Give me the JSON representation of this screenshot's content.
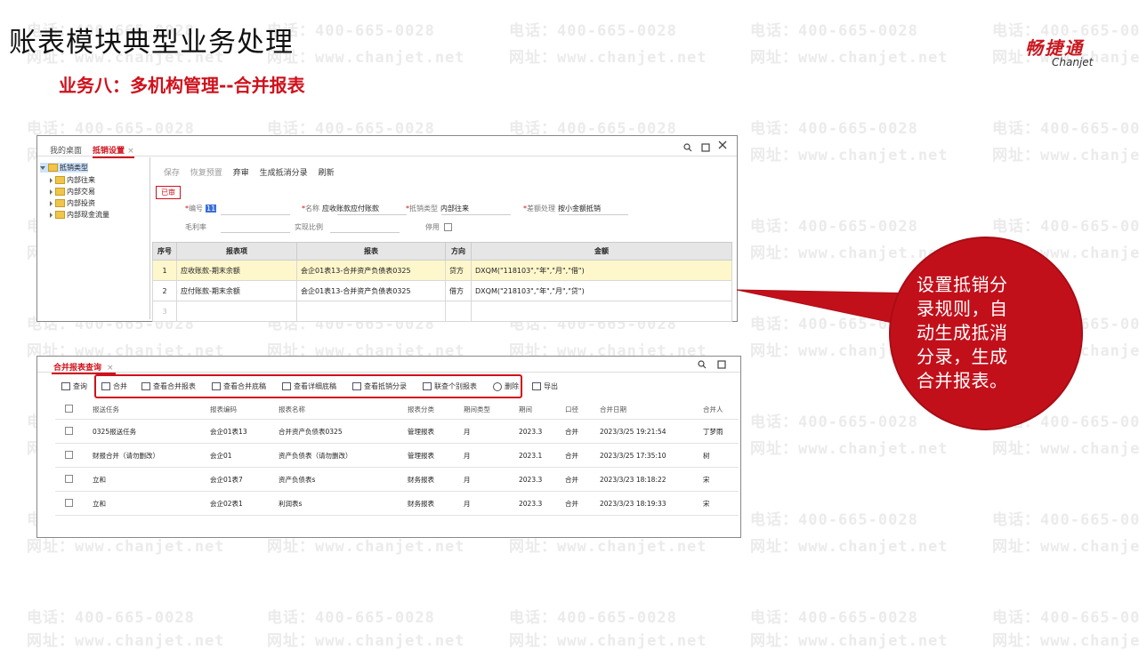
{
  "watermark": {
    "phone": "电话：400-665-0028",
    "site": "网址：www.chanjet.net"
  },
  "slide": {
    "title": "账表模块典型业务处理",
    "subtitle": "业务八：多机构管理--合并报表",
    "logo_cn": "畅捷通",
    "logo_en": "Chanjet"
  },
  "win1": {
    "tabs": [
      "我的桌面",
      "抵销设置"
    ],
    "tab_close": "×",
    "tree": {
      "root": "抵销类型",
      "children": [
        "内部往来",
        "内部交易",
        "内部投资",
        "内部现金流量"
      ]
    },
    "toolbar": [
      "保存",
      "恢复预置",
      "弃审",
      "生成抵消分录",
      "刷新"
    ],
    "status_badge": "已审",
    "fields": {
      "code_label": "编号",
      "code_value": "11",
      "name_label": "名称",
      "name_value": "应收账款应付账款",
      "type_label": "抵销类型",
      "type_value": "内部往来",
      "diff_label": "差额处理",
      "diff_value": "按小金额抵销",
      "subject_label": "毛利率",
      "ratio_label": "实现比例",
      "disable_label": "停用"
    },
    "grid": {
      "headers": [
        "序号",
        "报表项",
        "报表",
        "方向",
        "金额"
      ],
      "rows": [
        [
          "1",
          "应收账款-期末余额",
          "会企01表13-合并资产负债表0325",
          "贷方",
          "DXQM(\"118103\",\"年\",\"月\",\"借\")"
        ],
        [
          "2",
          "应付账款-期末余额",
          "会企01表13-合并资产负债表0325",
          "借方",
          "DXQM(\"218103\",\"年\",\"月\",\"贷\")"
        ],
        [
          "3",
          "",
          "",
          "",
          ""
        ]
      ]
    }
  },
  "win2": {
    "tab": "合并报表查询",
    "tab_close": "×",
    "toolbar": {
      "query": "查询",
      "merge": "合并",
      "view_merge": "查看合并报表",
      "view_draft": "查看合并底稿",
      "view_detail": "查看详细底稿",
      "view_offset": "查看抵销分录",
      "drill": "联查个别报表",
      "delete": "删除",
      "export": "导出"
    },
    "grid": {
      "headers": [
        "报送任务",
        "报表编码",
        "报表名称",
        "报表分类",
        "期间类型",
        "期间",
        "口径",
        "合并日期",
        "合并人"
      ],
      "rows": [
        [
          "0325报送任务",
          "会企01表13",
          "合并资产负债表0325",
          "管理报表",
          "月",
          "2023.3",
          "合并",
          "2023/3/25 19:21:54",
          "丁梦雨"
        ],
        [
          "财报合并（请勿删改）",
          "会企01",
          "资产负债表（请勿删改）",
          "管理报表",
          "月",
          "2023.1",
          "合并",
          "2023/3/25 17:35:10",
          "树"
        ],
        [
          "立和",
          "会企01表7",
          "资产负债表s",
          "财务报表",
          "月",
          "2023.3",
          "合并",
          "2023/3/23 18:18:22",
          "宋"
        ],
        [
          "立和",
          "会企02表1",
          "利润表s",
          "财务报表",
          "月",
          "2023.3",
          "合并",
          "2023/3/23 18:19:33",
          "宋"
        ]
      ]
    }
  },
  "callout": {
    "lines": [
      "设置抵销分",
      "录规则，自",
      "动生成抵消",
      "分录，生成",
      "合并报表。"
    ]
  },
  "colors": {
    "accent_red": "#d0101b",
    "row_highlight": "#fff7cc"
  }
}
